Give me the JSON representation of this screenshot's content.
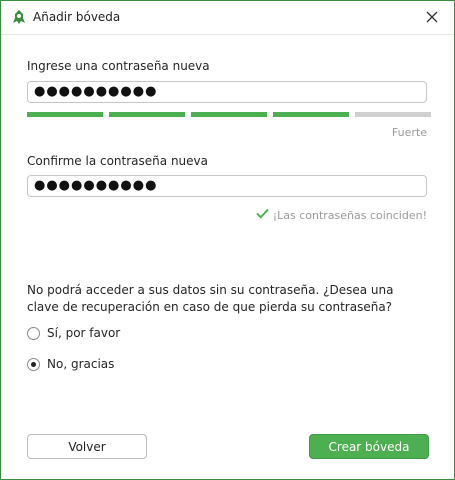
{
  "window": {
    "title": "Añadir bóveda"
  },
  "new_password": {
    "label": "Ingrese una contraseña nueva",
    "value": "●●●●●●●●●●",
    "strength": {
      "level": 4,
      "max": 5,
      "text": "Fuerte",
      "active_color": "#4caf50",
      "inactive_color": "#d0d0d0"
    }
  },
  "confirm_password": {
    "label": "Confirme la contraseña nueva",
    "value": "●●●●●●●●●●",
    "match_text": "¡Las contraseñas coinciden!",
    "match_color": "#4caf50"
  },
  "recovery": {
    "question": "No podrá acceder a sus datos sin su contraseña. ¿Desea una clave de recuperación en caso de que pierda su contraseña?",
    "options": [
      {
        "label": "Sí, por favor",
        "selected": false
      },
      {
        "label": "No, gracias",
        "selected": true
      }
    ]
  },
  "buttons": {
    "back": "Volver",
    "create": "Crear bóveda"
  }
}
